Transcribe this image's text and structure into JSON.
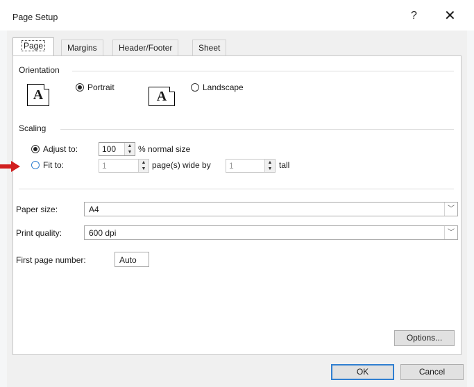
{
  "window": {
    "title": "Page Setup",
    "help_glyph": "?",
    "close_glyph": "✕"
  },
  "tabs": [
    {
      "label": "Page",
      "active": true
    },
    {
      "label": "Margins",
      "active": false
    },
    {
      "label": "Header/Footer",
      "active": false
    },
    {
      "label": "Sheet",
      "active": false
    }
  ],
  "orientation": {
    "group_label": "Orientation",
    "icon_letter": "A",
    "portrait_label": "Portrait",
    "landscape_label": "Landscape",
    "selected": "portrait"
  },
  "scaling": {
    "group_label": "Scaling",
    "adjust_to_label": "Adjust to:",
    "adjust_value": "100",
    "adjust_suffix": "% normal size",
    "fit_to_label": "Fit to:",
    "fit_wide_value": "1",
    "fit_wide_suffix": "page(s) wide by",
    "fit_tall_value": "1",
    "fit_tall_suffix": "tall",
    "selected": "adjust"
  },
  "paper": {
    "paper_size_label": "Paper size:",
    "paper_size_value": "A4",
    "print_quality_label": "Print quality:",
    "print_quality_value": "600 dpi",
    "first_page_label": "First page number:",
    "first_page_value": "Auto"
  },
  "buttons": {
    "options": "Options...",
    "ok": "OK",
    "cancel": "Cancel"
  },
  "colors": {
    "accent": "#2f7fd1",
    "indicator_arrow": "#d11f1f"
  }
}
